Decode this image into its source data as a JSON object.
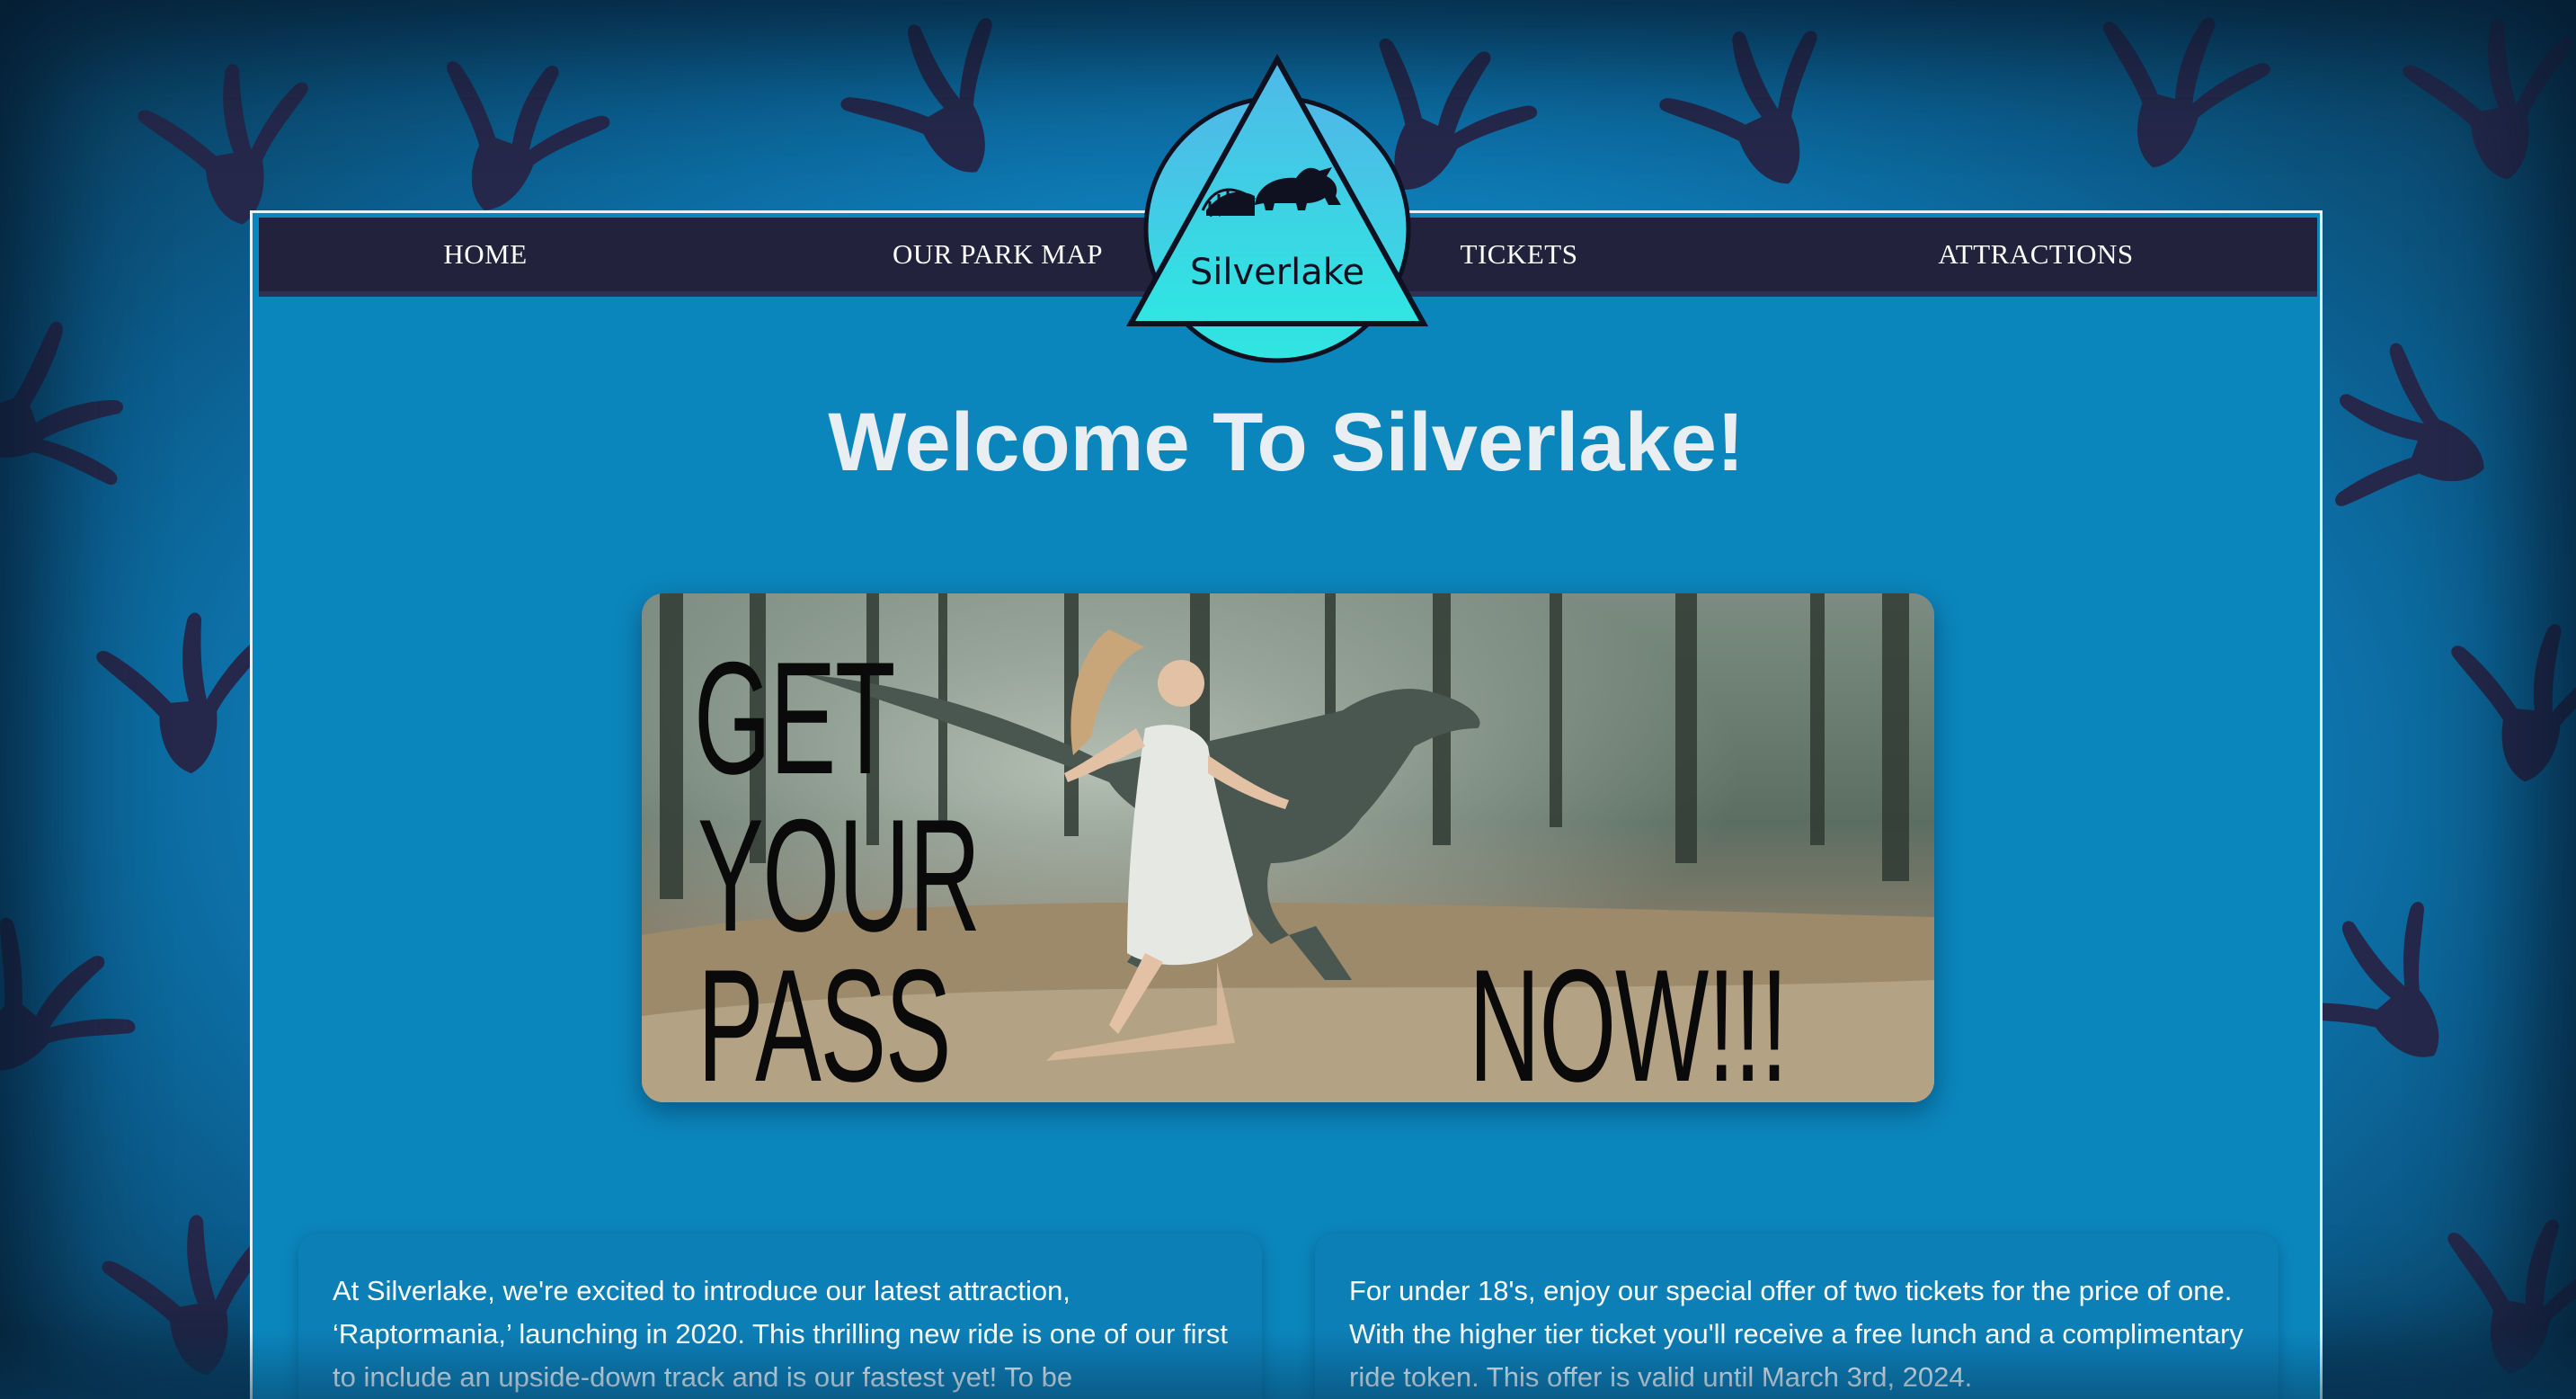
{
  "nav": {
    "home": "HOME",
    "park_map": "OUR PARK MAP",
    "tickets": "TICKETS",
    "attractions": "ATTRACTIONS"
  },
  "logo": {
    "text": "Silverlake",
    "icon": "triceratops-rollercoaster-icon"
  },
  "page_title": "Welcome To Silverlake!",
  "banner": {
    "line1": "GET",
    "line2": "YOUR",
    "line3": "PASS",
    "line4": "NOW!!!",
    "image": "girl-running-from-raptor-in-forest"
  },
  "cards": {
    "left_text": "At Silverlake, we're excited to introduce our latest attraction, ‘Raptormania,’ launching in 2020. This thrilling new ride is one of our first to include an upside-down track and is our fastest yet! To be",
    "right_text": "For under 18's, enjoy our special offer of two tickets for the price of one. With the higher tier ticket you'll receive a free lunch and a complimentary ride token. This offer is valid until March 3rd, 2024."
  },
  "colors": {
    "navbar": "#22223d",
    "panel": "#0b86bd",
    "logo_fill": "#35d6e6",
    "footprint": "#25284a"
  }
}
